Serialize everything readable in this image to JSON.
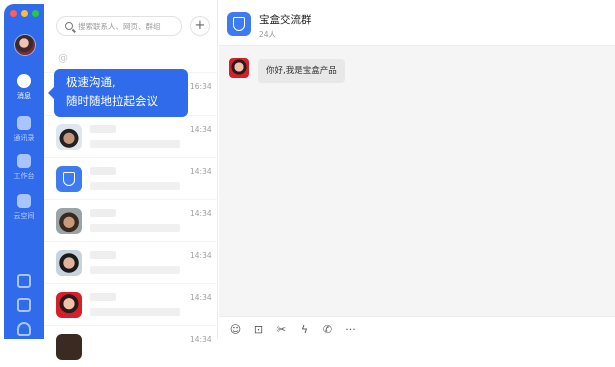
{
  "window": {
    "traffic_colors": [
      "#ff5f57",
      "#febc2e",
      "#28c840"
    ]
  },
  "rail": {
    "items": [
      {
        "label": "消息",
        "icon": "chat-bubble-icon",
        "active": true
      },
      {
        "label": "通讯录",
        "icon": "contacts-book-icon"
      },
      {
        "label": "工作台",
        "icon": "grid-apps-icon"
      },
      {
        "label": "云空间",
        "icon": "cloud-drive-icon"
      }
    ],
    "bottom_icons": [
      "calendar-icon",
      "document-icon",
      "thunder-icon"
    ],
    "accent": "#2f6bea"
  },
  "search": {
    "placeholder": "搜索联系人、网页、群组",
    "add_label": "+"
  },
  "list": {
    "at_symbol": "@",
    "rows": [
      {
        "time": "16:34"
      },
      {
        "time": "14:34"
      },
      {
        "time": "14:34"
      },
      {
        "time": "14:34"
      },
      {
        "time": "14:34"
      },
      {
        "time": "14:34"
      },
      {
        "time": "14:34"
      }
    ]
  },
  "tooltip": {
    "line1": "极速沟通,",
    "line2": "随时随地拉起会议"
  },
  "chat": {
    "title": "宝盒交流群",
    "member_count": "24人",
    "messages": [
      {
        "text": "你好,我是宝盒产品"
      }
    ],
    "toolbar": [
      "emoji-icon",
      "image-icon",
      "scissors-icon",
      "flash-icon",
      "phone-icon",
      "more-icon"
    ],
    "toolbar_glyphs": [
      "☺",
      "⊡",
      "✂",
      "ϟ",
      "✆",
      "···"
    ]
  }
}
